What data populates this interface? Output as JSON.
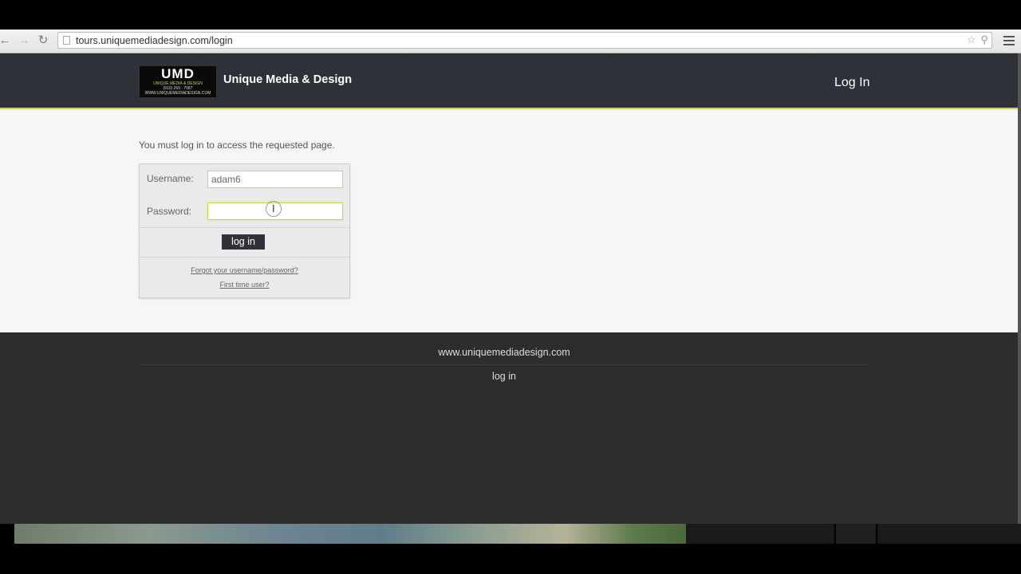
{
  "browser": {
    "url": "tours.uniquemediadesign.com/login",
    "back_icon": "back-arrow-icon",
    "forward_icon": "forward-arrow-icon",
    "reload_icon": "reload-icon"
  },
  "header": {
    "logo_mark": "UMD",
    "logo_line1": "UNIQUE MEDIA & DESIGN",
    "logo_line2": "(910) 269 - 7087",
    "logo_line3": "WWW.UNIQUEMEDIADESIGN.COM",
    "site_name": "Unique Media & Design",
    "login_link": "Log In",
    "accent_color": "#c9d54a"
  },
  "main": {
    "notice": "You must log in to access the requested page.",
    "username_label": "Username:",
    "username_value": "adam6",
    "password_label": "Password:",
    "password_value": "",
    "login_button": "log in",
    "forgot_link": "Forgot your username/password?",
    "first_time_link": "First time user?"
  },
  "footer": {
    "site_url": "www.uniquemediadesign.com",
    "login_link": "log in"
  }
}
